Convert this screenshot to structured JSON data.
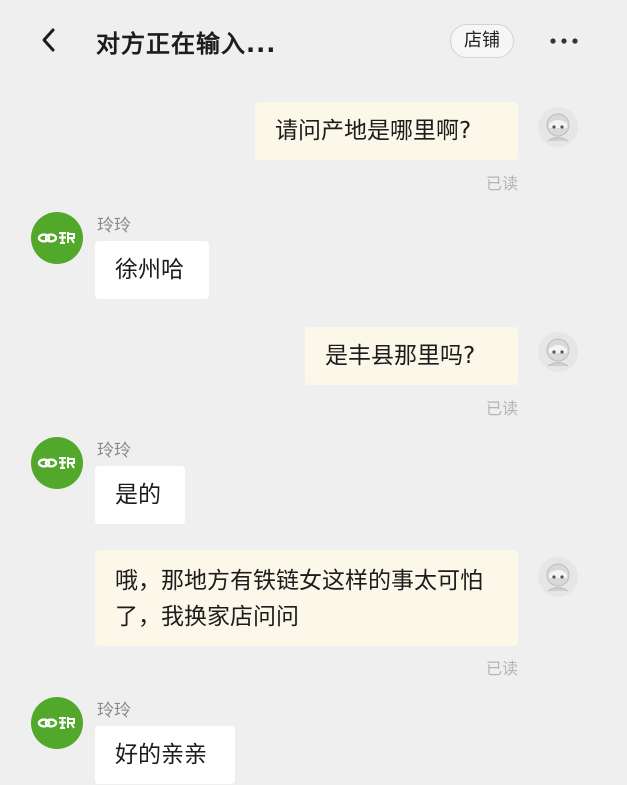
{
  "header": {
    "title": "对方正在输入...",
    "store_label": "店铺",
    "back_icon": "chevron-left-icon",
    "more_icon": "more-horizontal-icon"
  },
  "colors": {
    "background": "#efefef",
    "outgoing_bubble": "#fbf7e9",
    "incoming_bubble": "#ffffff",
    "shop_avatar": "#52a82a",
    "read_status": "#b4b4b4"
  },
  "messages": [
    {
      "direction": "out",
      "text": "请问产地是哪里啊?",
      "status": "已读"
    },
    {
      "direction": "in",
      "sender": "玲玲",
      "text": "徐州哈"
    },
    {
      "direction": "out",
      "text": "是丰县那里吗?",
      "status": "已读"
    },
    {
      "direction": "in",
      "sender": "玲玲",
      "text": "是的"
    },
    {
      "direction": "out",
      "text": "哦，那地方有铁链女这样的事太可怕了，我换家店问问",
      "status": "已读"
    },
    {
      "direction": "in",
      "sender": "玲玲",
      "text": "好的亲亲"
    }
  ]
}
